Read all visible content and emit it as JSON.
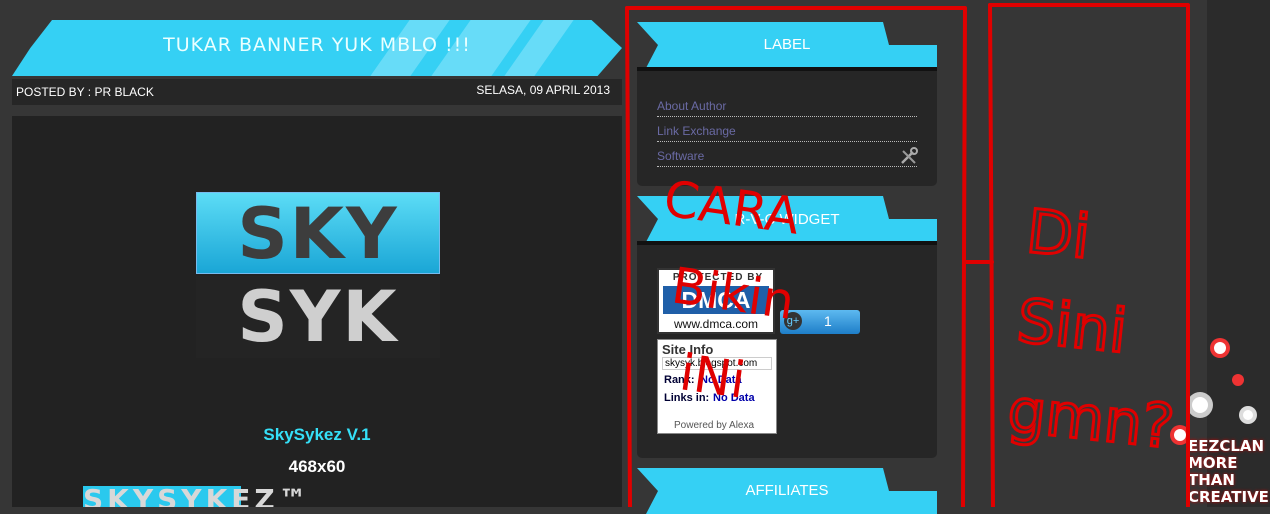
{
  "post": {
    "title": "TUKAR BANNER YUK MBLO !!!",
    "posted_by": "POSTED BY : PR BLACK",
    "date": "SELASA, 09 APRIL 2013",
    "logo_top": "SKY",
    "logo_bottom": "SYK",
    "name": "SkySykez V.1",
    "size": "468x60",
    "banner_text": "SKYSYKEZ™"
  },
  "sidebar": {
    "label_title": "LABEL",
    "labels": [
      "About Author",
      "Link Exchange",
      "Software"
    ],
    "widget_title": "R-V-C WIDGET",
    "dmca": {
      "protected": "PROTECTED BY",
      "logo": "DMCA",
      "url": "www.dmca.com"
    },
    "gplus_count": "1",
    "alexa": {
      "heading": "Site Info",
      "url": "skysyk.blogspot.com",
      "rank_label": "Rank:",
      "rank_value": "No Data",
      "links_label": "Links in:",
      "links_value": "No Data",
      "powered": "Powered by Alexa"
    },
    "affiliates_title": "AFFILIATES"
  },
  "annotations": {
    "left_note": "CARA Bikin iNi",
    "right_note": "Di Sini gmn?",
    "color": "#e00000"
  },
  "decal": {
    "text": [
      "EEZCLAN",
      "MORE THAN",
      "CREATIVE"
    ]
  },
  "colors": {
    "accent": "#35d0f4",
    "background": "#363636",
    "panel": "#262626"
  }
}
